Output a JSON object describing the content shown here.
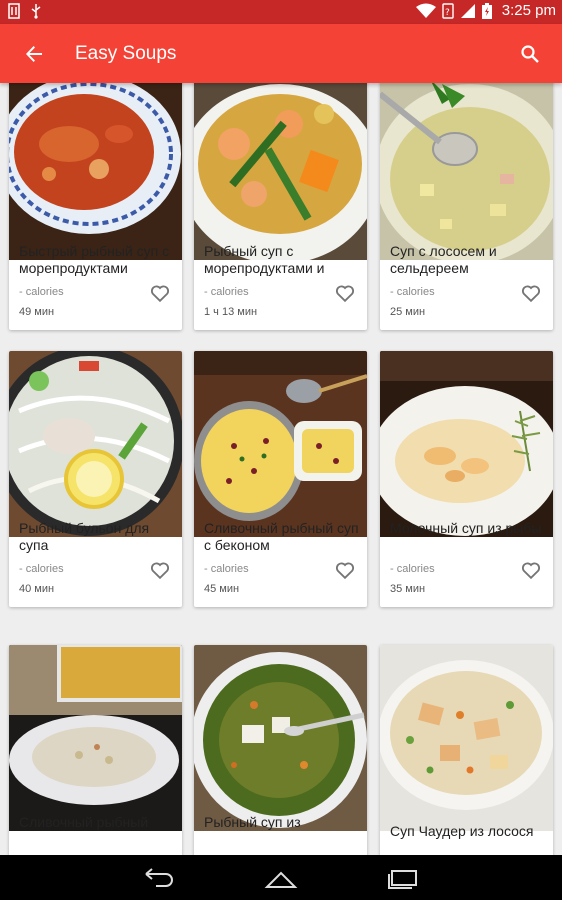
{
  "status_bar": {
    "time": "3:25 pm",
    "icons": [
      "sim-icon",
      "usb-icon",
      "wifi-icon",
      "data-icon",
      "signal-icon",
      "battery-icon"
    ]
  },
  "app_bar": {
    "title": "Easy Soups",
    "back_icon": "arrow-back-icon",
    "search_icon": "search-icon",
    "color": "#f44336"
  },
  "recipes": [
    {
      "title": "Быстрый рыбный суп с морепродуктами",
      "calories": "- calories",
      "time": "49 мин"
    },
    {
      "title": "Рыбный суп с морепродуктами и",
      "calories": "- calories",
      "time": "1 ч 13 мин"
    },
    {
      "title": "Суп с лососем и сельдереем",
      "calories": "- calories",
      "time": "25 мин"
    },
    {
      "title": "Рыбный бульон для супа",
      "calories": "- calories",
      "time": "40 мин"
    },
    {
      "title": "Сливочный рыбный суп с беконом",
      "calories": "- calories",
      "time": "45 мин"
    },
    {
      "title": "Молочный суп из рыбы",
      "calories": "- calories",
      "time": "35 мин"
    },
    {
      "title": "Сливочный рыбный",
      "calories": "",
      "time": ""
    },
    {
      "title": "Рыбный суп из",
      "calories": "",
      "time": ""
    },
    {
      "title": "Суп Чаудер из лосося",
      "calories": "",
      "time": ""
    }
  ],
  "nav_bar": {
    "icons": [
      "back-nav-icon",
      "home-nav-icon",
      "recents-nav-icon"
    ]
  }
}
